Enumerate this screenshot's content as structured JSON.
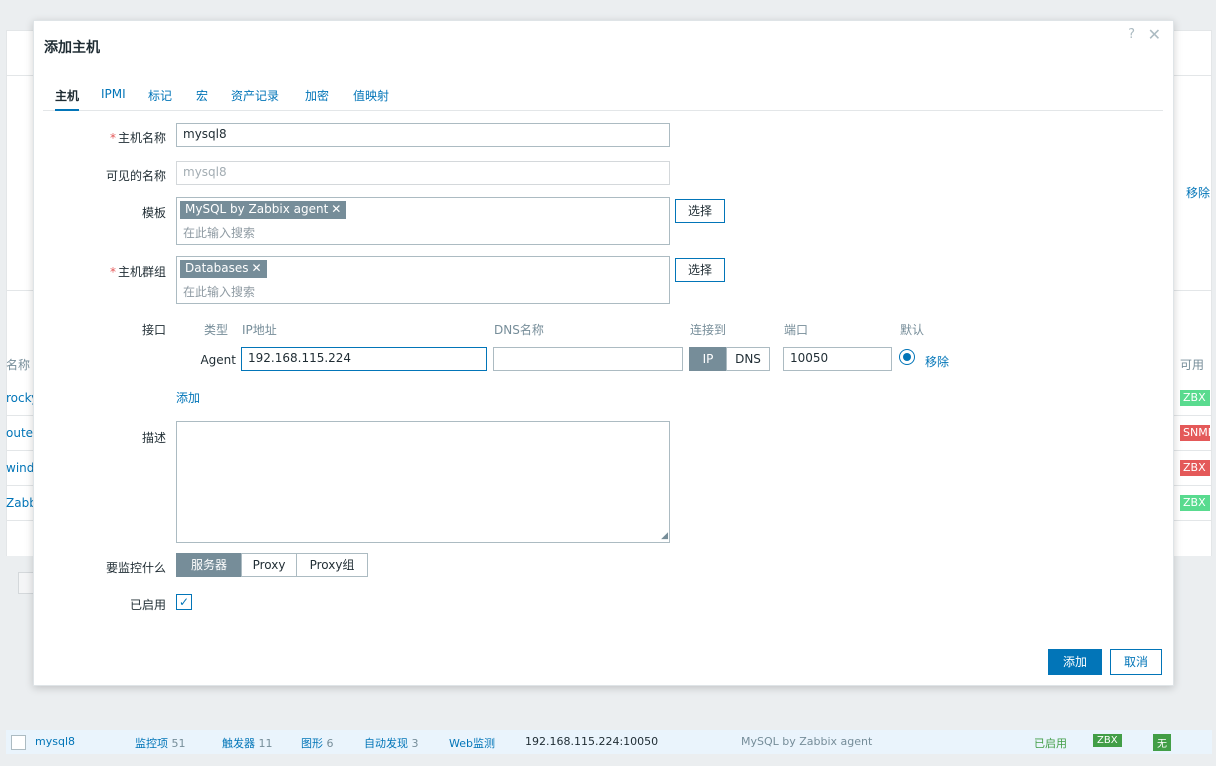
{
  "background": {
    "remove_link": "移除",
    "name_header": "名称",
    "availability_header": "可用",
    "host_names": [
      "rocky",
      "outer",
      "windo",
      "Zabbi"
    ],
    "tags": [
      {
        "text": "ZBX",
        "color": "#59db8f"
      },
      {
        "text": "SNMP",
        "color": "#e45959"
      },
      {
        "text": "ZBX",
        "color": "#e45959"
      },
      {
        "text": "ZBX",
        "color": "#59db8f"
      }
    ],
    "bottom_row": {
      "host": "mysql8",
      "items_label": "监控项",
      "items_count": "51",
      "triggers_label": "触发器",
      "triggers_count": "11",
      "graphs_label": "图形",
      "graphs_count": "6",
      "discovery_label": "自动发现",
      "discovery_count": "3",
      "web_label": "Web监测",
      "interface": "192.168.115.224:10050",
      "template": "MySQL by Zabbix agent",
      "status": "已启用",
      "zbx": "ZBX",
      "none": "无"
    }
  },
  "dialog": {
    "title": "添加主机",
    "help": "?",
    "close": "✕",
    "tabs": [
      "主机",
      "IPMI",
      "标记",
      "宏",
      "资产记录",
      "加密",
      "值映射"
    ],
    "host_name_label": "主机名称",
    "host_name_value": "mysql8",
    "visible_name_label": "可见的名称",
    "visible_name_placeholder": "mysql8",
    "templates_label": "模板",
    "template_chip": "MySQL by Zabbix agent",
    "templates_placeholder": "在此输入搜索",
    "select_button": "选择",
    "host_groups_label": "主机群组",
    "group_chip": "Databases",
    "groups_placeholder": "在此输入搜索",
    "interfaces_label": "接口",
    "iface_headers": {
      "type": "类型",
      "ip": "IP地址",
      "dns": "DNS名称",
      "connect": "连接到",
      "port": "端口",
      "default": "默认"
    },
    "iface": {
      "type": "Agent",
      "ip": "192.168.115.224",
      "dns": "",
      "connect_ip": "IP",
      "connect_dns": "DNS",
      "port": "10050",
      "remove": "移除"
    },
    "add_link": "添加",
    "description_label": "描述",
    "monitored_by_label": "要监控什么",
    "monitored_by_options": [
      "服务器",
      "Proxy",
      "Proxy组"
    ],
    "enabled_label": "已启用",
    "checkmark": "✓",
    "resize_glyph": "◢",
    "add_button": "添加",
    "cancel_button": "取消"
  }
}
